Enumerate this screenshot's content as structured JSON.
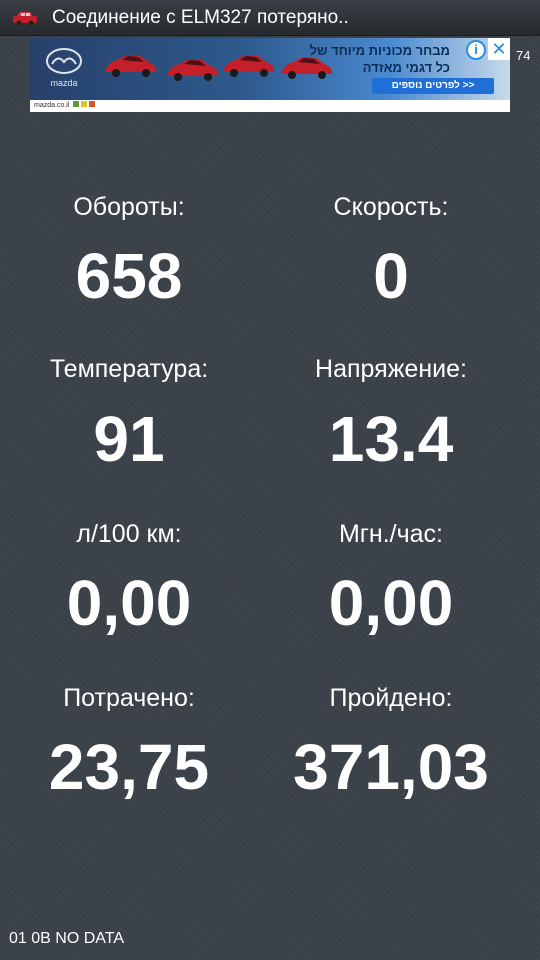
{
  "status_bar": {
    "title": "Соединение с ELM327 потеряно..",
    "icon": "red-car-icon"
  },
  "ad": {
    "brand_logo_text": "mazda",
    "headline": "מבחר מכוניות מיוחד של כל דגמי מאזדה",
    "cta_label": "<< לפרטים נוספים",
    "footer_url": "mazda.co.il",
    "footer_text": "לפרטים: mazda.co.il",
    "info_icon": "info-icon",
    "close_icon": "close-icon",
    "counter": "74",
    "colors": {
      "banner_dark": "#27406a",
      "banner_light": "#c8daea",
      "cta": "#1f6fd6",
      "car": "#c3202a"
    }
  },
  "gauges": [
    {
      "label": "Обороты:",
      "value": "658"
    },
    {
      "label": "Скорость:",
      "value": "0"
    },
    {
      "label": "Температура:",
      "value": "91"
    },
    {
      "label": "Напряжение:",
      "value": "13.4"
    },
    {
      "label": "л/100 км:",
      "value": "0,00"
    },
    {
      "label": "Мгн./час:",
      "value": "0,00"
    },
    {
      "label": "Потрачено:",
      "value": "23,75"
    },
    {
      "label": "Пройдено:",
      "value": "371,03"
    }
  ],
  "footer": {
    "status_text": "01 0B NO DATA"
  },
  "colors": {
    "background": "#3b4249",
    "text": "#ffffff",
    "status_bar": "#2e3338"
  }
}
